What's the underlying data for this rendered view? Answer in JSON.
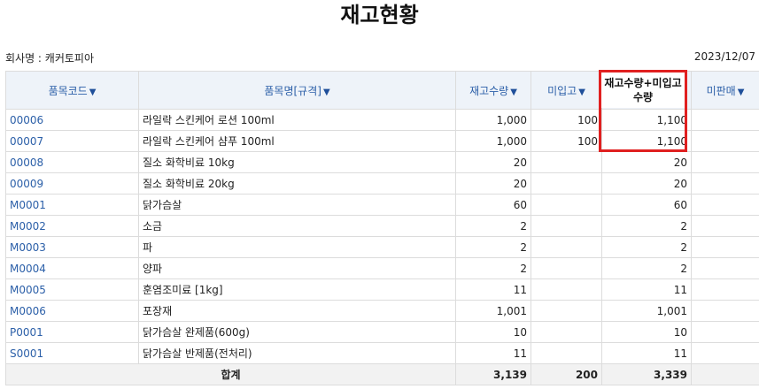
{
  "title": "재고현황",
  "company_label": "회사명 : 캐커토피아",
  "date": "2023/12/07",
  "columns": {
    "code": "품목코드",
    "name": "품목명[규격]",
    "stock": "재고수량",
    "unreceived": "미입고",
    "sum": "재고수량+미입고수량",
    "unsold": "미판매"
  },
  "rows": [
    {
      "code": "00006",
      "name": "라일락 스킨케어 로션 100ml",
      "stock": "1,000",
      "unreceived": "100",
      "sum": "1,100",
      "unsold": ""
    },
    {
      "code": "00007",
      "name": "라일락 스킨케어 샴푸 100ml",
      "stock": "1,000",
      "unreceived": "100",
      "sum": "1,100",
      "unsold": ""
    },
    {
      "code": "00008",
      "name": "질소 화학비료 10kg",
      "stock": "20",
      "unreceived": "",
      "sum": "20",
      "unsold": ""
    },
    {
      "code": "00009",
      "name": "질소 화학비료 20kg",
      "stock": "20",
      "unreceived": "",
      "sum": "20",
      "unsold": ""
    },
    {
      "code": "M0001",
      "name": "닭가슴살",
      "stock": "60",
      "unreceived": "",
      "sum": "60",
      "unsold": ""
    },
    {
      "code": "M0002",
      "name": "소금",
      "stock": "2",
      "unreceived": "",
      "sum": "2",
      "unsold": ""
    },
    {
      "code": "M0003",
      "name": "파",
      "stock": "2",
      "unreceived": "",
      "sum": "2",
      "unsold": ""
    },
    {
      "code": "M0004",
      "name": "양파",
      "stock": "2",
      "unreceived": "",
      "sum": "2",
      "unsold": ""
    },
    {
      "code": "M0005",
      "name": "훈염조미료 [1kg]",
      "stock": "11",
      "unreceived": "",
      "sum": "11",
      "unsold": ""
    },
    {
      "code": "M0006",
      "name": "포장재",
      "stock": "1,001",
      "unreceived": "",
      "sum": "1,001",
      "unsold": ""
    },
    {
      "code": "P0001",
      "name": "닭가슴살 완제품(600g)",
      "stock": "10",
      "unreceived": "",
      "sum": "10",
      "unsold": ""
    },
    {
      "code": "S0001",
      "name": "닭가슴살 반제품(전처리)",
      "stock": "11",
      "unreceived": "",
      "sum": "11",
      "unsold": ""
    }
  ],
  "total": {
    "label": "합계",
    "stock": "3,139",
    "unreceived": "200",
    "sum": "3,339",
    "unsold": ""
  },
  "highlight_color": "#e02020",
  "sort_icon": "triangle-down"
}
